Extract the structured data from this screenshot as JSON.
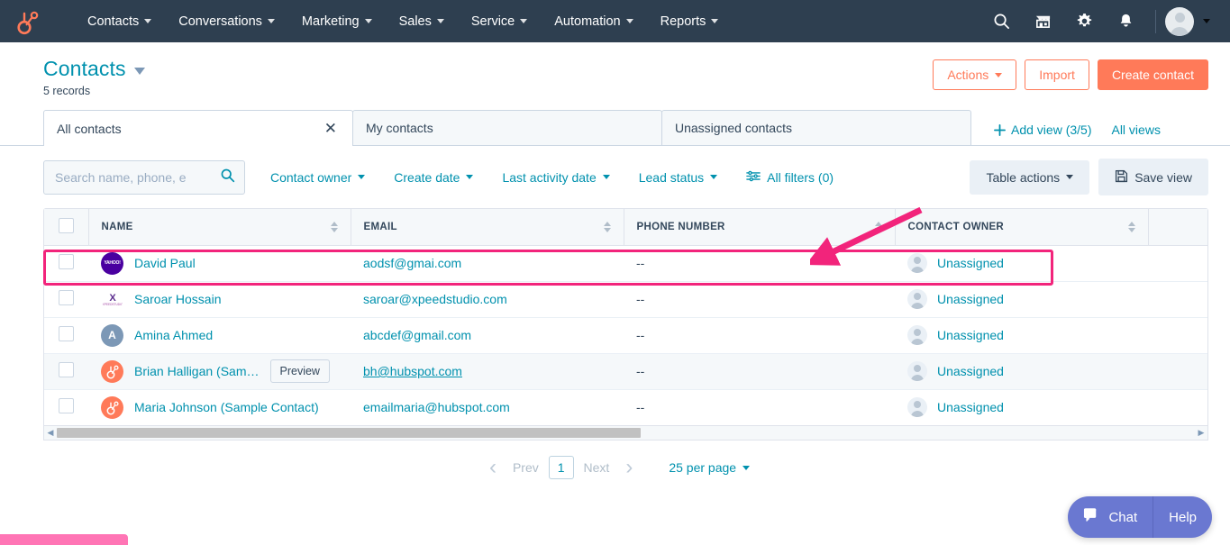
{
  "topnav": {
    "logo_icon": "hubspot-sprocket-logo",
    "items": [
      {
        "label": "Contacts",
        "has_caret": true
      },
      {
        "label": "Conversations",
        "has_caret": true
      },
      {
        "label": "Marketing",
        "has_caret": true
      },
      {
        "label": "Sales",
        "has_caret": true
      },
      {
        "label": "Service",
        "has_caret": true
      },
      {
        "label": "Automation",
        "has_caret": true
      },
      {
        "label": "Reports",
        "has_caret": true
      }
    ],
    "right_icons": [
      "search-icon",
      "marketplace-icon",
      "settings-gear-icon",
      "notifications-bell-icon"
    ],
    "avatar_icon": "user-avatar",
    "background_color": "#2e3f50"
  },
  "header": {
    "title": "Contacts",
    "records": "5 records",
    "title_color": "#0091ae",
    "buttons": {
      "actions": "Actions",
      "import": "Import",
      "create": "Create contact"
    },
    "accent_color": "#ff7a59"
  },
  "views": {
    "tabs": [
      {
        "label": "All contacts",
        "active": true,
        "closable": true
      },
      {
        "label": "My contacts",
        "active": false,
        "closable": false
      },
      {
        "label": "Unassigned contacts",
        "active": false,
        "closable": false
      }
    ],
    "add_view": "Add view (3/5)",
    "all_views": "All views"
  },
  "toolbar": {
    "search_placeholder": "Search name, phone, e",
    "search_value": "",
    "search_icon": "search-icon",
    "filters": [
      {
        "label": "Contact owner"
      },
      {
        "label": "Create date"
      },
      {
        "label": "Last activity date"
      },
      {
        "label": "Lead status"
      }
    ],
    "all_filters": "All filters (0)",
    "all_filters_icon": "filter-sliders-icon",
    "table_actions": "Table actions",
    "save_view": "Save view",
    "save_icon": "floppy-disk-icon"
  },
  "table": {
    "columns": [
      {
        "key": "name",
        "label": "NAME",
        "sortable": true
      },
      {
        "key": "email",
        "label": "EMAIL",
        "sortable": true
      },
      {
        "key": "phone",
        "label": "PHONE NUMBER",
        "sortable": true
      },
      {
        "key": "owner",
        "label": "CONTACT OWNER",
        "sortable": true
      }
    ],
    "rows": [
      {
        "name": "David Paul",
        "email": "aodsf@gmai.com",
        "phone": "--",
        "owner": "Unassigned",
        "avatar_type": "yahoo",
        "avatar_text": "YAHOO!",
        "highlighted": true,
        "hovered": false,
        "preview_button": null,
        "email_underlined": false
      },
      {
        "name": "Saroar Hossain",
        "email": "saroar@xpeedstudio.com",
        "phone": "--",
        "owner": "Unassigned",
        "avatar_type": "xpeed",
        "avatar_text": "X",
        "highlighted": false,
        "hovered": false,
        "preview_button": null,
        "email_underlined": false
      },
      {
        "name": "Amina Ahmed",
        "email": "abcdef@gmail.com",
        "phone": "--",
        "owner": "Unassigned",
        "avatar_type": "letter",
        "avatar_text": "A",
        "highlighted": false,
        "hovered": false,
        "preview_button": null,
        "email_underlined": false
      },
      {
        "name": "Brian Halligan (Sam…",
        "email": "bh@hubspot.com",
        "phone": "--",
        "owner": "Unassigned",
        "avatar_type": "hubspot",
        "avatar_text": "",
        "highlighted": false,
        "hovered": true,
        "preview_button": "Preview",
        "email_underlined": true
      },
      {
        "name": "Maria Johnson (Sample Contact)",
        "email": "emailmaria@hubspot.com",
        "phone": "--",
        "owner": "Unassigned",
        "avatar_type": "hubspot",
        "avatar_text": "",
        "highlighted": false,
        "hovered": false,
        "preview_button": null,
        "email_underlined": false
      }
    ],
    "highlight_color": "#f2247b",
    "annotation_arrow_color": "#f2247b"
  },
  "pagination": {
    "prev": "Prev",
    "next": "Next",
    "current_page": "1",
    "per_page": "25 per page"
  },
  "chat_widget": {
    "chat_label": "Chat",
    "help_label": "Help",
    "chat_icon": "speech-bubble-icon",
    "background_color": "#6a78d1"
  }
}
